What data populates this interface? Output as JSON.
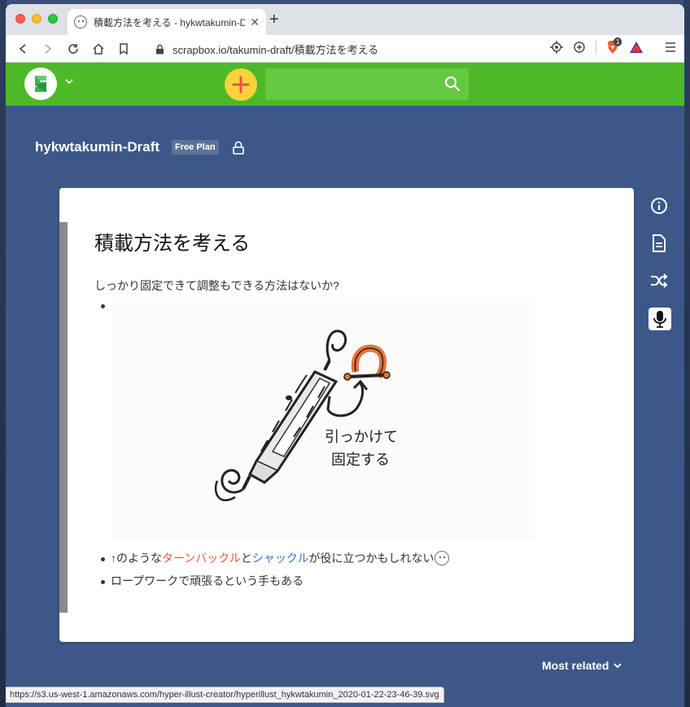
{
  "browser": {
    "tab_title": "積載方法を考える - hykwtakumin-D",
    "tab_close": "✕",
    "new_tab": "+",
    "url": "scrapbox.io/takumin-draft/積載方法を考える",
    "brave_badge": "1",
    "status_url": "https://s3.us-west-1.amazonaws.com/hyper-illust-creator/hyperillust_hykwtakumin_2020-01-22-23-46-39.svg"
  },
  "header": {
    "search_placeholder": ""
  },
  "project": {
    "name": "hykwtakumin-Draft",
    "plan": "Free Plan"
  },
  "page": {
    "title": "積載方法を考える",
    "line1": "しっかり固定できて調整もできる方法はないか?",
    "line3": {
      "prefix": "↑のような",
      "link1": "ターンバックル",
      "middle": "と",
      "link2": "シャックル",
      "suffix": "が役に立つかもしれない"
    },
    "line4": "ロープワークで頑張るという手もある",
    "illust_text1": "引っかけて",
    "illust_text2": "固定する"
  },
  "footer": {
    "most_related": "Most related"
  },
  "colors": {
    "header_green": "#4cb928",
    "background": "#3c5889",
    "link_red": "#e8563f",
    "link_blue": "#3b6fd1"
  }
}
